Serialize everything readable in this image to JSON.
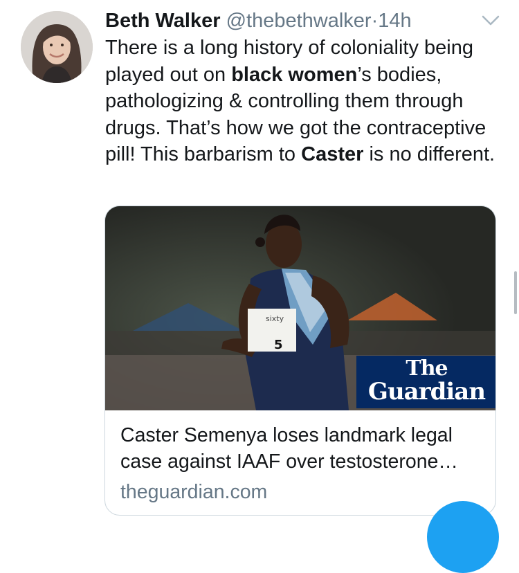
{
  "tweet": {
    "author_name": "Beth Walker",
    "handle": "@thebethwalker",
    "separator": "·",
    "time": "14h",
    "text_parts": [
      "There is a long history of coloniality being played out on ",
      "black women",
      "’s bodies, pathologizing & controlling them through drugs. That’s how we got the contraceptive pill! This barbarism to ",
      "Caster",
      " is no different."
    ]
  },
  "card": {
    "title": "Caster Semenya loses landmark legal case against IAAF over testosterone…",
    "domain": "theguardian.com",
    "logo_line1": "The",
    "logo_line2": "Guardian",
    "bib_text": "sixty",
    "bib_number": "5"
  },
  "icons": {
    "caret": "chevron-down-icon",
    "fab": "compose-fab"
  },
  "colors": {
    "text": "#14171a",
    "secondary": "#657786",
    "card_border": "#ccd6dd",
    "guardian_blue": "#052962",
    "twitter_blue": "#1da1f2"
  }
}
